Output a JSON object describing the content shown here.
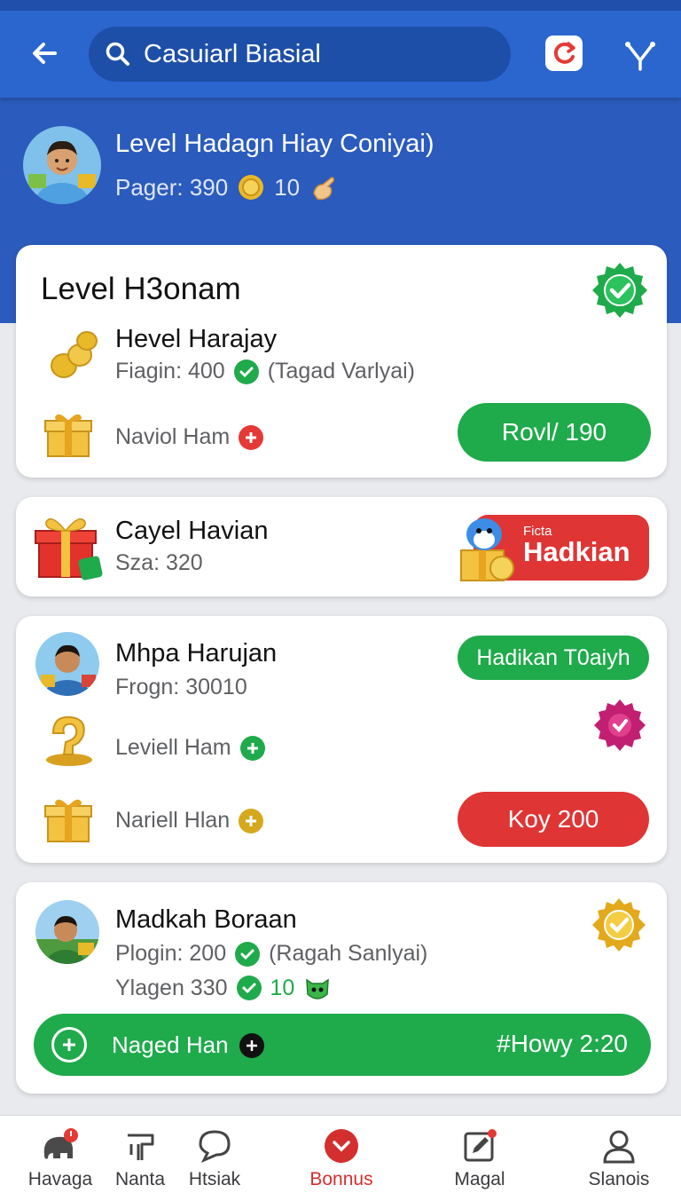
{
  "search": {
    "value": "Casuiarl Biasial"
  },
  "profile": {
    "title": "Level Hadagn Hiay Coniyai)",
    "pager_label": "Pager: 390",
    "coins": "10"
  },
  "card1": {
    "heading": "Level H3onam",
    "title": "Hevel Harajay",
    "sub_label": "Fiagin: 400",
    "sub_note": "(Tagad Varlyai)",
    "reward_label": "Naviol Ham",
    "action_label": "Rovl/ 190"
  },
  "card2": {
    "title": "Cayel Havian",
    "sub_label": "Sza: 320",
    "badge_small": "Ficta",
    "badge_label": "Hadkian"
  },
  "card3": {
    "title": "Mhpa Harujan",
    "sub_label": "Frogn: 30010",
    "tag_label": "Hadikan T0aiyh",
    "row1_label": "Leviell Ham",
    "row2_label": "Nariell Hlan",
    "action_label": "Koy 200"
  },
  "card4": {
    "title": "Madkah Boraan",
    "row1_label": "Plogin: 200",
    "row1_note": "(Ragah Sanlyai)",
    "row2_label": "Ylagen 330",
    "row2_value": "10",
    "bar_label": "Naged Han",
    "bar_value": "#Howy 2:20"
  },
  "nav": {
    "items": [
      {
        "label": "Havaga",
        "icon": "elephant-icon"
      },
      {
        "label": "Nanta",
        "icon": "sign-icon"
      },
      {
        "label": "Htsiak",
        "icon": "chat-icon"
      },
      {
        "label": "Bonnus",
        "icon": "bonus-icon",
        "active": true
      },
      {
        "label": "Magal",
        "icon": "edit-icon"
      },
      {
        "label": "Slanois",
        "icon": "profile-icon"
      }
    ]
  },
  "colors": {
    "primary": "#2b66cf",
    "hero": "#2b5bbd",
    "green": "#1faa4b",
    "red": "#df3535",
    "gold": "#e8b928"
  }
}
